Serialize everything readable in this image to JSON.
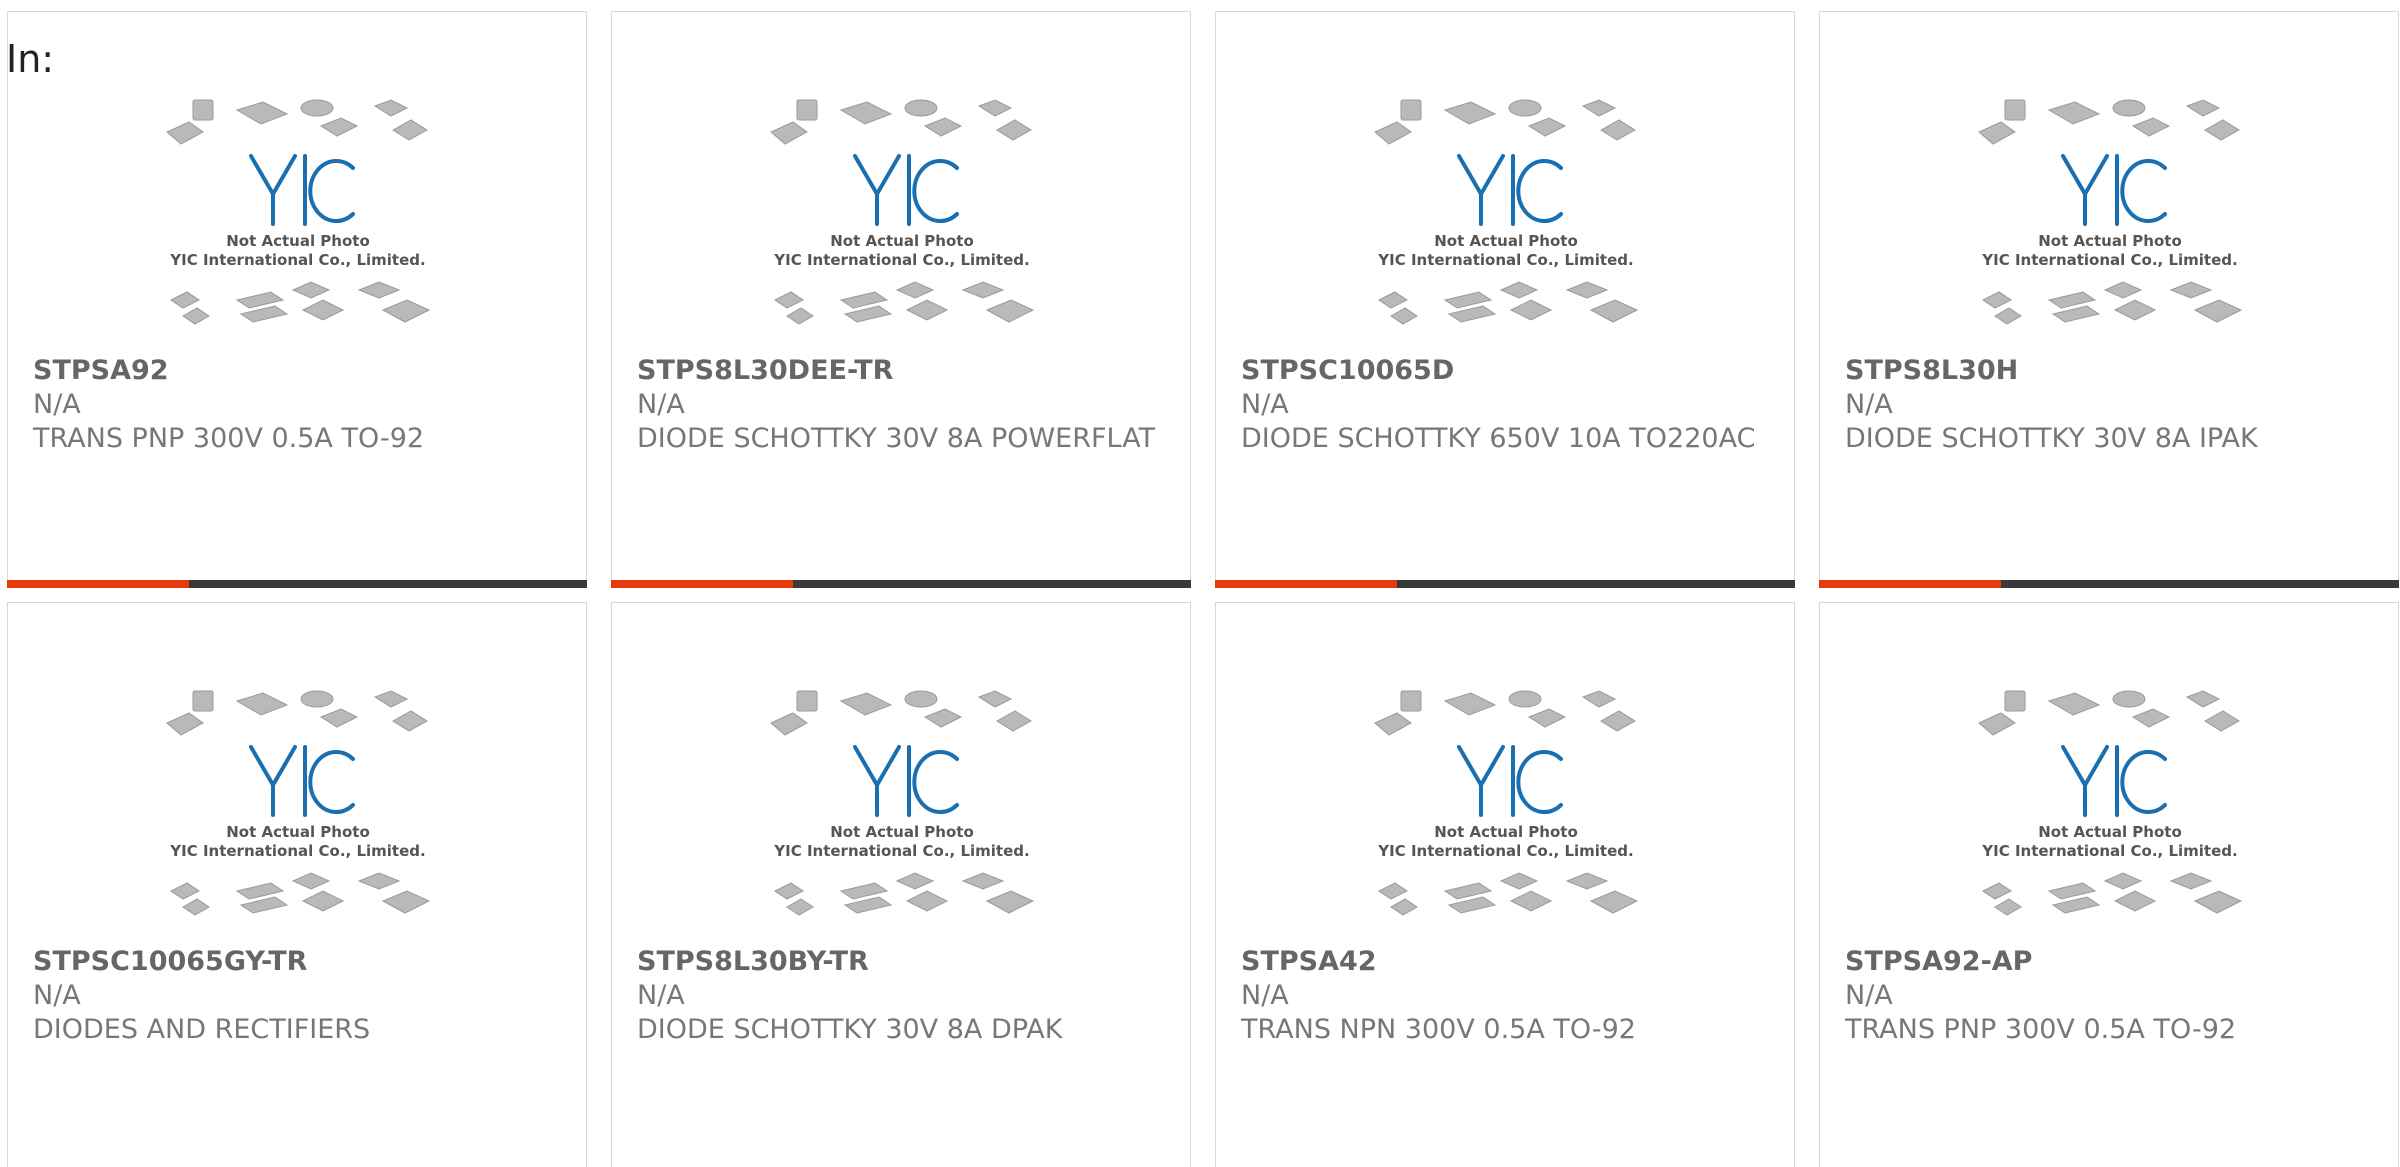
{
  "header": {
    "label": "In:"
  },
  "image_caption": {
    "line1": "Not Actual Photo",
    "line2": "YIC International Co., Limited."
  },
  "image_logo": "YIC",
  "colors": {
    "accent": "#e63a0c",
    "bar": "#3a3a3a",
    "logo": "#1a6fb0",
    "text": "#777777"
  },
  "products": [
    {
      "part": "STPSA92",
      "availability": "N/A",
      "description": "TRANS PNP 300V 0.5A TO-92"
    },
    {
      "part": "STPS8L30DEE-TR",
      "availability": "N/A",
      "description": "DIODE SCHOTTKY 30V 8A POWERFLAT"
    },
    {
      "part": "STPSC10065D",
      "availability": "N/A",
      "description": "DIODE SCHOTTKY 650V 10A TO220AC"
    },
    {
      "part": "STPS8L30H",
      "availability": "N/A",
      "description": "DIODE SCHOTTKY 30V 8A IPAK"
    },
    {
      "part": "STPSC10065GY-TR",
      "availability": "N/A",
      "description": "DIODES AND RECTIFIERS"
    },
    {
      "part": "STPS8L30BY-TR",
      "availability": "N/A",
      "description": "DIODE SCHOTTKY 30V 8A DPAK"
    },
    {
      "part": "STPSA42",
      "availability": "N/A",
      "description": "TRANS NPN 300V 0.5A TO-92"
    },
    {
      "part": "STPSA92-AP",
      "availability": "N/A",
      "description": "TRANS PNP 300V 0.5A TO-92"
    }
  ]
}
